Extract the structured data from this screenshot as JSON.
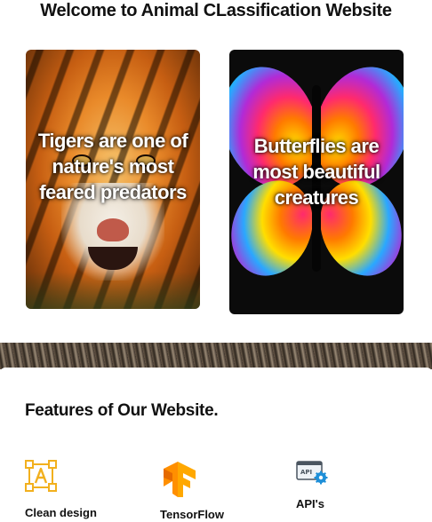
{
  "header": {
    "title": "Welcome to Animal CLassification Website"
  },
  "cards": [
    {
      "animal": "tiger",
      "caption": "Tigers are one of nature's most feared predators"
    },
    {
      "animal": "butterfly",
      "caption": "Butterflies are most beautiful creatures"
    }
  ],
  "features": {
    "title": "Features of Our Website.",
    "items": [
      {
        "label": "Clean design",
        "icon": "design-frame-icon"
      },
      {
        "label": "TensorFlow",
        "icon": "tensorflow-logo-icon"
      },
      {
        "label": "API's",
        "icon": "api-gear-icon"
      }
    ]
  },
  "colors": {
    "tiger_orange": "#e98a2a",
    "tensorflow_orange": "#ff8f00",
    "frame_yellow": "#f2b01e",
    "api_blue": "#1e8fd8"
  }
}
